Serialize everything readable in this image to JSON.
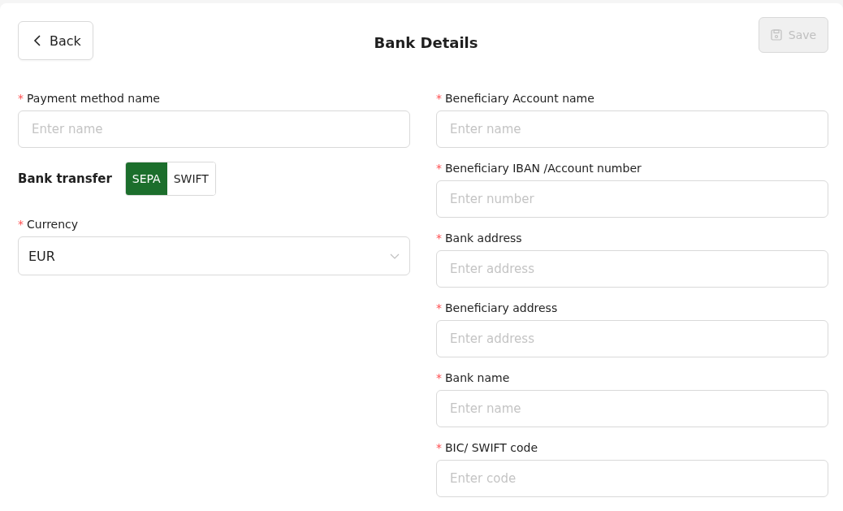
{
  "header": {
    "back_button": "Back",
    "title": "Bank Details",
    "save_button": {
      "label": "Save",
      "disabled": true
    }
  },
  "left_fields": [
    {
      "kind": "input",
      "required_mark": "*",
      "label": "Payment method name",
      "placeholder": "Enter name"
    },
    {
      "kind": "toggle",
      "label": "Bank transfer",
      "options": [
        {
          "label": "SEPA",
          "selected": true
        },
        {
          "label": "SWIFT",
          "selected": false
        }
      ]
    },
    {
      "kind": "select",
      "required_mark": "*",
      "label": "Currency",
      "value": "EUR"
    }
  ],
  "right_fields": [
    {
      "kind": "input",
      "required_mark": "*",
      "label": "Beneficiary Account name",
      "placeholder": "Enter name"
    },
    {
      "kind": "input",
      "required_mark": "*",
      "label": "Beneficiary IBAN /Account number",
      "placeholder": "Enter number"
    },
    {
      "kind": "input",
      "required_mark": "*",
      "label": "Bank address",
      "placeholder": "Enter address"
    },
    {
      "kind": "input",
      "required_mark": "*",
      "label": "Beneficiary address",
      "placeholder": "Enter address"
    },
    {
      "kind": "input",
      "required_mark": "*",
      "label": "Bank name",
      "placeholder": "Enter name"
    },
    {
      "kind": "input",
      "required_mark": "*",
      "label": "BIC/ SWIFT code",
      "placeholder": "Enter code"
    }
  ]
}
